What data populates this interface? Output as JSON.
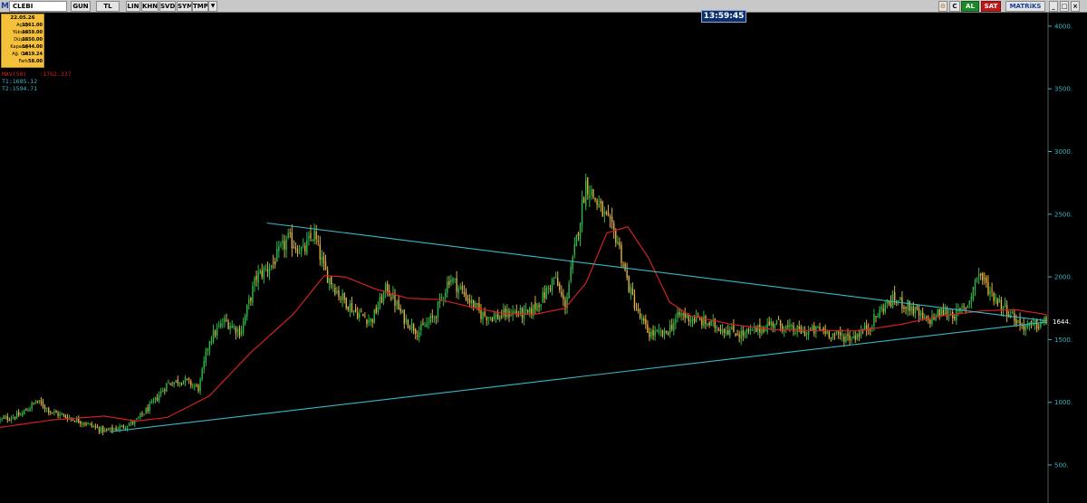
{
  "toolbar": {
    "logo": "M",
    "symbol": "CLEBI",
    "buttons": [
      "GUN",
      "TL",
      "LIN",
      "KHN",
      "SVD",
      "SYM",
      "TMP"
    ],
    "right_buttons": {
      "c": "C",
      "al": "AL",
      "sat": "SAT",
      "brand": "MATRiKS"
    }
  },
  "clock": "13:59:45",
  "ohlc": {
    "date": "22.05.26",
    "rows": [
      {
        "label": "Açılış",
        "value": "1561.00"
      },
      {
        "label": "Yüksek",
        "value": "1659.00"
      },
      {
        "label": "Düşük",
        "value": "1550.00"
      },
      {
        "label": "Kapanış",
        "value": "1644.00"
      },
      {
        "label": "Ağ. Ort",
        "value": "1619.24"
      },
      {
        "label": "Fark",
        "value": "58.00"
      }
    ]
  },
  "indicators": {
    "ma_label": "MAV(50)",
    "ma_value": ":1762.337",
    "t1": "T1:1685.12",
    "t2": "T2:1594.71"
  },
  "colors": {
    "background": "#000000",
    "candle_up": "#2db84a",
    "candle_down": "#e0b040",
    "moving_average": "#d42020",
    "trendline": "#37b8c4",
    "axis_text": "#37b8c4",
    "panel": "#f6c13a"
  },
  "chart_data": {
    "type": "candlestick",
    "y_axis": {
      "position": "right",
      "ticks": [
        500,
        1000,
        1500,
        2000,
        2500,
        3000,
        3500,
        4000
      ],
      "ylim": [
        300,
        4100
      ]
    },
    "last_price_label": "1644.",
    "close_path": [
      [
        0,
        860
      ],
      [
        0.02,
        900
      ],
      [
        0.035,
        1010
      ],
      [
        0.05,
        920
      ],
      [
        0.065,
        880
      ],
      [
        0.08,
        840
      ],
      [
        0.1,
        770
      ],
      [
        0.115,
        800
      ],
      [
        0.13,
        850
      ],
      [
        0.145,
        980
      ],
      [
        0.16,
        1150
      ],
      [
        0.175,
        1180
      ],
      [
        0.19,
        1110
      ],
      [
        0.2,
        1500
      ],
      [
        0.215,
        1650
      ],
      [
        0.23,
        1560
      ],
      [
        0.245,
        2000
      ],
      [
        0.26,
        2100
      ],
      [
        0.275,
        2300
      ],
      [
        0.29,
        2200
      ],
      [
        0.3,
        2350
      ],
      [
        0.31,
        2050
      ],
      [
        0.325,
        1850
      ],
      [
        0.34,
        1720
      ],
      [
        0.355,
        1650
      ],
      [
        0.37,
        1920
      ],
      [
        0.385,
        1680
      ],
      [
        0.4,
        1560
      ],
      [
        0.415,
        1680
      ],
      [
        0.43,
        2000
      ],
      [
        0.445,
        1850
      ],
      [
        0.46,
        1700
      ],
      [
        0.475,
        1680
      ],
      [
        0.49,
        1720
      ],
      [
        0.505,
        1700
      ],
      [
        0.52,
        1850
      ],
      [
        0.53,
        2000
      ],
      [
        0.54,
        1760
      ],
      [
        0.55,
        2250
      ],
      [
        0.56,
        2750
      ],
      [
        0.57,
        2600
      ],
      [
        0.58,
        2450
      ],
      [
        0.59,
        2300
      ],
      [
        0.6,
        1950
      ],
      [
        0.61,
        1700
      ],
      [
        0.62,
        1550
      ],
      [
        0.635,
        1540
      ],
      [
        0.65,
        1700
      ],
      [
        0.665,
        1660
      ],
      [
        0.68,
        1620
      ],
      [
        0.695,
        1580
      ],
      [
        0.71,
        1540
      ],
      [
        0.725,
        1580
      ],
      [
        0.74,
        1640
      ],
      [
        0.755,
        1580
      ],
      [
        0.77,
        1560
      ],
      [
        0.785,
        1580
      ],
      [
        0.8,
        1530
      ],
      [
        0.815,
        1520
      ],
      [
        0.83,
        1600
      ],
      [
        0.845,
        1770
      ],
      [
        0.855,
        1820
      ],
      [
        0.87,
        1760
      ],
      [
        0.885,
        1640
      ],
      [
        0.9,
        1720
      ],
      [
        0.915,
        1700
      ],
      [
        0.925,
        1780
      ],
      [
        0.935,
        2040
      ],
      [
        0.945,
        1900
      ],
      [
        0.955,
        1800
      ],
      [
        0.965,
        1720
      ],
      [
        0.975,
        1620
      ],
      [
        0.985,
        1600
      ],
      [
        1.0,
        1644
      ]
    ],
    "moving_average": {
      "name": "MAV(50)",
      "path": [
        [
          0,
          800
        ],
        [
          0.05,
          860
        ],
        [
          0.1,
          890
        ],
        [
          0.13,
          850
        ],
        [
          0.16,
          880
        ],
        [
          0.2,
          1050
        ],
        [
          0.24,
          1400
        ],
        [
          0.28,
          1700
        ],
        [
          0.31,
          2010
        ],
        [
          0.33,
          2000
        ],
        [
          0.36,
          1900
        ],
        [
          0.39,
          1830
        ],
        [
          0.42,
          1820
        ],
        [
          0.45,
          1760
        ],
        [
          0.48,
          1710
        ],
        [
          0.51,
          1700
        ],
        [
          0.54,
          1750
        ],
        [
          0.56,
          1950
        ],
        [
          0.58,
          2350
        ],
        [
          0.6,
          2400
        ],
        [
          0.62,
          2150
        ],
        [
          0.64,
          1800
        ],
        [
          0.66,
          1690
        ],
        [
          0.7,
          1620
        ],
        [
          0.74,
          1580
        ],
        [
          0.78,
          1570
        ],
        [
          0.82,
          1570
        ],
        [
          0.86,
          1620
        ],
        [
          0.9,
          1690
        ],
        [
          0.94,
          1730
        ],
        [
          0.97,
          1740
        ],
        [
          1.0,
          1700
        ]
      ]
    },
    "trendlines": [
      {
        "name": "T1",
        "from": [
          0.255,
          2430
        ],
        "to": [
          1.0,
          1650
        ]
      },
      {
        "name": "T2",
        "from": [
          0.105,
          765
        ],
        "to": [
          1.0,
          1640
        ]
      }
    ],
    "grid": false
  }
}
